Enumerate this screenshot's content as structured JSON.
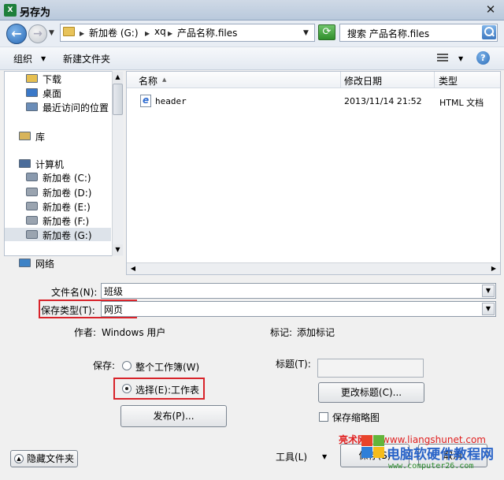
{
  "window": {
    "app_icon_text": "X",
    "title": "另存为",
    "close_glyph": "✕"
  },
  "address": {
    "path": [
      "新加卷 (G:)",
      "xq",
      "产品名称.files"
    ],
    "search_placeholder": "搜索 产品名称.files"
  },
  "toolbar": {
    "organize": "组织",
    "new_folder": "新建文件夹"
  },
  "nav": {
    "items": [
      {
        "label": "下载",
        "icon": "download-folder-icon"
      },
      {
        "label": "桌面",
        "icon": "desktop-icon"
      },
      {
        "label": "最近访问的位置",
        "icon": "recent-places-icon"
      },
      {
        "label": "库",
        "icon": "library-icon"
      },
      {
        "label": "计算机",
        "icon": "computer-icon"
      },
      {
        "label": "新加卷 (C:)",
        "icon": "system-drive-icon"
      },
      {
        "label": "新加卷 (D:)",
        "icon": "drive-icon"
      },
      {
        "label": "新加卷 (E:)",
        "icon": "drive-icon"
      },
      {
        "label": "新加卷 (F:)",
        "icon": "drive-icon"
      },
      {
        "label": "新加卷 (G:)",
        "icon": "drive-icon"
      },
      {
        "label": "网络",
        "icon": "network-icon"
      }
    ],
    "selected_index": 9
  },
  "list": {
    "columns": [
      "名称",
      "修改日期",
      "类型"
    ],
    "rows": [
      {
        "name": "header",
        "date": "2013/11/14 21:52",
        "type": "HTML 文档"
      }
    ]
  },
  "form": {
    "filename_label": "文件名(N):",
    "filename_value": "班级",
    "savetype_label": "保存类型(T):",
    "savetype_value": "网页",
    "author_label": "作者:",
    "author_value": "Windows 用户",
    "tags_label": "标记:",
    "tags_value": "添加标记",
    "save_label": "保存:",
    "radio_workbook": "整个工作簿(W)",
    "radio_selection": "选择(E):工作表",
    "title_label": "标题(T):",
    "change_title_btn": "更改标题(C)...",
    "publish_btn": "发布(P)...",
    "thumbnail_label": "保存缩略图"
  },
  "footer": {
    "hide_folders": "隐藏文件夹",
    "tools": "工具(L)",
    "save_btn": "保存(S)",
    "cancel_btn": "取消"
  },
  "watermark": {
    "brand": "亮术网",
    "url": "www.liangshunet.com",
    "title": "电脑软硬件教程网",
    "sub": "www.computer26.com"
  },
  "colors": {
    "highlight_box": "#d8232a",
    "selected_nav": "#dde3ea"
  }
}
